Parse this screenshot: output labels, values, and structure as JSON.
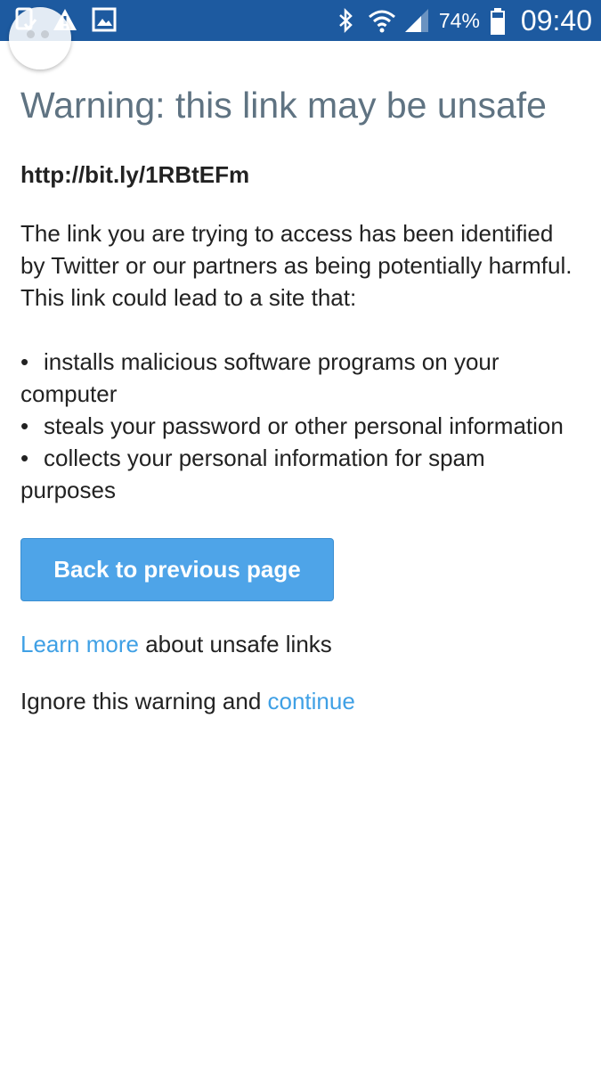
{
  "status_bar": {
    "battery_percent": "74%",
    "time": "09:40",
    "icons": [
      "screenshot-icon",
      "warning-icon",
      "image-icon",
      "bluetooth-icon",
      "wifi-icon",
      "signal-icon",
      "battery-icon"
    ],
    "background_color": "#1d5aa0"
  },
  "page": {
    "title": "Warning: this link may be unsafe",
    "url": "http://bit.ly/1RBtEFm",
    "description": "The link you are trying to access has been identified by Twitter or our partners as being potentially harmful. This link could lead to a site that:",
    "risks": [
      {
        "bullet": "•",
        "text": "installs malicious software programs on your computer"
      },
      {
        "bullet": "•",
        "text": "steals your password or other personal information"
      },
      {
        "bullet": "•",
        "text": "collects your personal information for spam purposes"
      }
    ],
    "back_button_label": "Back to previous page",
    "learn_more_link": "Learn more",
    "learn_more_rest": " about unsafe links",
    "ignore_text": "Ignore this warning and ",
    "continue_link": "continue"
  },
  "colors": {
    "button": "#4ea4e8",
    "link": "#3fa0e5",
    "title": "#5f7382"
  }
}
